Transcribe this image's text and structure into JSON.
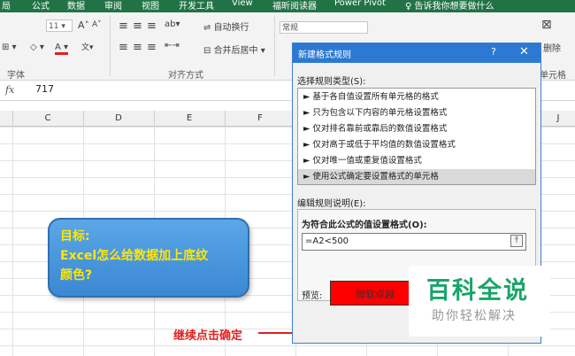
{
  "menubar": {
    "items": [
      "局",
      "公式",
      "数据",
      "审阅",
      "视图",
      "开发工具",
      "View",
      "福昕阅读器",
      "Power Pivot",
      "告诉我你想要做什么"
    ]
  },
  "ribbon": {
    "font_size": "11",
    "font_grow": "A",
    "font_shrink": "A",
    "wrap_text": "自动换行",
    "merge_center": "合并后居中",
    "number_format": "常规",
    "delete_label": "删除",
    "group_font": "字体",
    "group_alignment": "对齐方式",
    "group_cells": "单元格"
  },
  "formula_bar": {
    "fx": "fx",
    "value": "717"
  },
  "columns": [
    "C",
    "D",
    "E",
    "F",
    "J"
  ],
  "dialog": {
    "title": "新建格式规则",
    "help": "?",
    "close": "✕",
    "select_type_label": "选择规则类型(S):",
    "rule_types": [
      "基于各自值设置所有单元格的格式",
      "只为包含以下内容的单元格设置格式",
      "仅对排名靠前或靠后的数值设置格式",
      "仅对高于或低于平均值的数值设置格式",
      "仅对唯一值或重复值设置格式",
      "使用公式确定要设置格式的单元格"
    ],
    "selected_index": 5,
    "edit_desc_label": "编辑规则说明(E):",
    "formula_label": "为符合此公式的值设置格式(O):",
    "formula_value": "=A2<500",
    "preview_label": "预览:",
    "preview_text": "微软卓越",
    "preview_color": "#ff0000"
  },
  "callout": {
    "line1": "目标:",
    "line2": "Excel怎么给数据加上底纹",
    "line3": "颜色?"
  },
  "instruction": "继续点击确定",
  "watermark": {
    "title": "百科全说",
    "subtitle": "助你轻松解决"
  }
}
